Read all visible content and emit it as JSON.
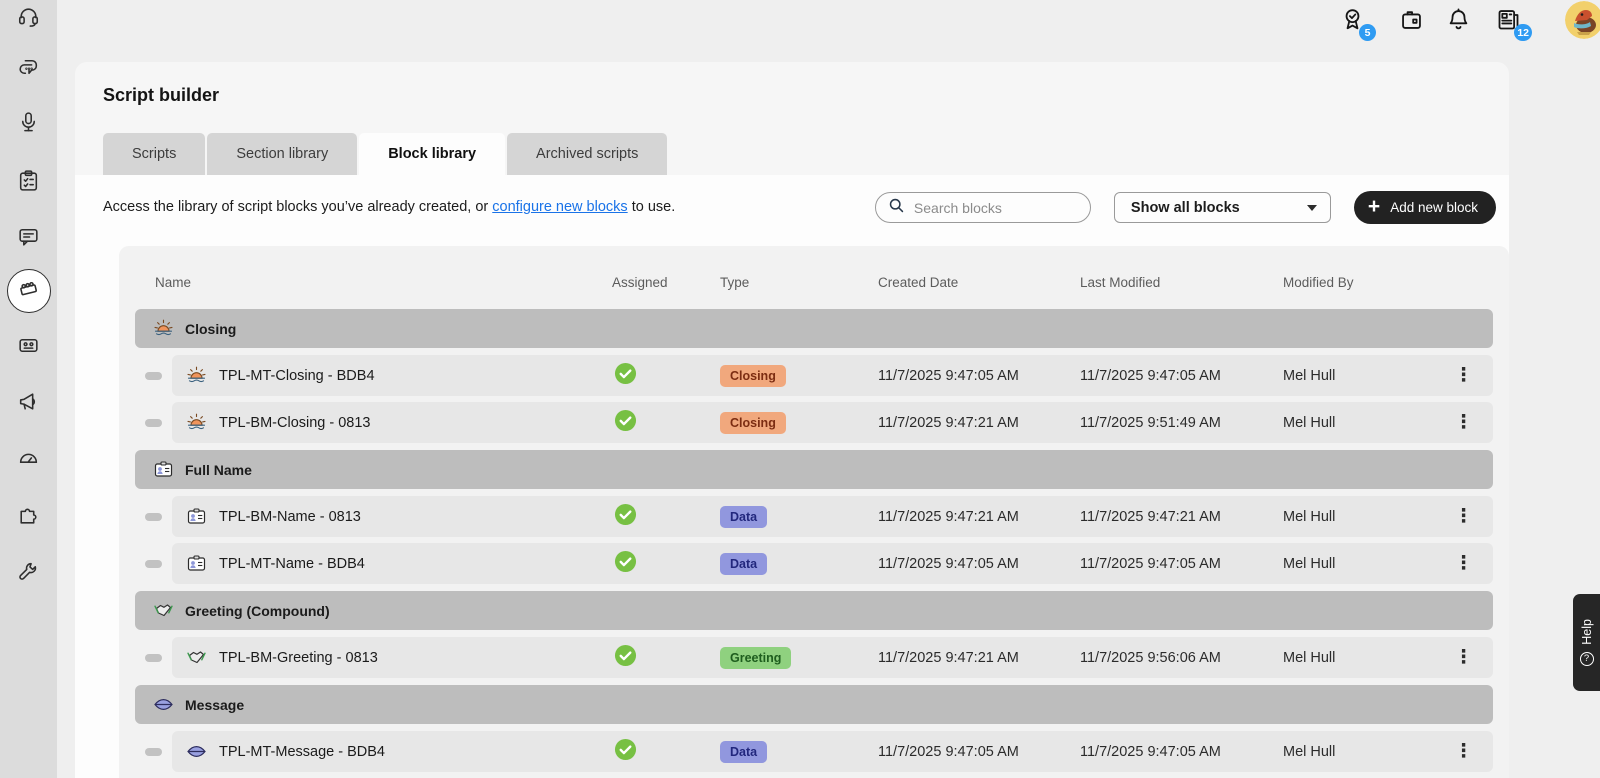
{
  "page": {
    "title": "Script builder"
  },
  "topbar": {
    "achievements_badge": "5",
    "news_badge": "12",
    "icons": [
      "ribbon-badge-icon",
      "wallet-icon",
      "bell-icon",
      "news-icon",
      "avatar"
    ]
  },
  "sidebar": {
    "items": [
      "headset-icon",
      "chat-bubbles-icon",
      "microphone-icon",
      "clipboard-check-icon",
      "chat-panel-icon",
      "lego-brick-icon",
      "keyboard-icon",
      "megaphone-icon",
      "gauge-icon",
      "puzzle-icon",
      "wrench-icon"
    ],
    "active_item": "lego-brick-icon"
  },
  "tabs": [
    {
      "label": "Scripts",
      "active": false
    },
    {
      "label": "Section library",
      "active": false
    },
    {
      "label": "Block library",
      "active": true
    },
    {
      "label": "Archived scripts",
      "active": false
    }
  ],
  "toolbar": {
    "description_before": "Access the library of script blocks you’ve already created, or ",
    "description_link": "configure new blocks",
    "description_after": " to use.",
    "search_placeholder": "Search blocks",
    "filter_value": "Show all blocks",
    "add_icon": "+",
    "add_label": "Add new block"
  },
  "table": {
    "columns": [
      "Name",
      "Assigned",
      "Type",
      "Created Date",
      "Last Modified",
      "Modified By"
    ],
    "groups": [
      {
        "label": "Closing",
        "icon": "sunrise-icon",
        "rows": [
          {
            "name": "TPL-MT-Closing - BDB4",
            "assigned": true,
            "type": "Closing",
            "created": "11/7/2025 9:47:05 AM",
            "modified": "11/7/2025 9:47:05 AM",
            "modified_by": "Mel Hull"
          },
          {
            "name": "TPL-BM-Closing - 0813",
            "assigned": true,
            "type": "Closing",
            "created": "11/7/2025 9:47:21 AM",
            "modified": "11/7/2025 9:51:49 AM",
            "modified_by": "Mel Hull"
          }
        ]
      },
      {
        "label": "Full Name",
        "icon": "id-card-icon",
        "rows": [
          {
            "name": "TPL-BM-Name - 0813",
            "assigned": true,
            "type": "Data",
            "created": "11/7/2025 9:47:21 AM",
            "modified": "11/7/2025 9:47:21 AM",
            "modified_by": "Mel Hull"
          },
          {
            "name": "TPL-MT-Name - BDB4",
            "assigned": true,
            "type": "Data",
            "created": "11/7/2025 9:47:05 AM",
            "modified": "11/7/2025 9:47:05 AM",
            "modified_by": "Mel Hull"
          }
        ]
      },
      {
        "label": "Greeting (Compound)",
        "icon": "handshake-icon",
        "rows": [
          {
            "name": "TPL-BM-Greeting - 0813",
            "assigned": true,
            "type": "Greeting",
            "created": "11/7/2025 9:47:21 AM",
            "modified": "11/7/2025 9:56:06 AM",
            "modified_by": "Mel Hull"
          }
        ]
      },
      {
        "label": "Message",
        "icon": "lips-icon",
        "rows": [
          {
            "name": "TPL-MT-Message - BDB4",
            "assigned": true,
            "type": "Data",
            "created": "11/7/2025 9:47:05 AM",
            "modified": "11/7/2025 9:47:05 AM",
            "modified_by": "Mel Hull"
          }
        ]
      }
    ]
  },
  "help": {
    "label": "Help"
  },
  "colors": {
    "link": "#1a73e8",
    "notification_badge": "#2f9bf2",
    "assigned_check": "#77c043",
    "badge_closing_bg": "#f1a87d",
    "badge_closing_text": "#7c2d12",
    "badge_data_bg": "#9197de",
    "badge_data_text": "#22277d",
    "badge_greeting_bg": "#8fd17f",
    "badge_greeting_text": "#1e5e1e",
    "group_bar": "#bdbdbd",
    "row_bg": "#e7e7e7",
    "add_button_bg": "#222222",
    "sidebar_bg": "#dcdcdc"
  }
}
